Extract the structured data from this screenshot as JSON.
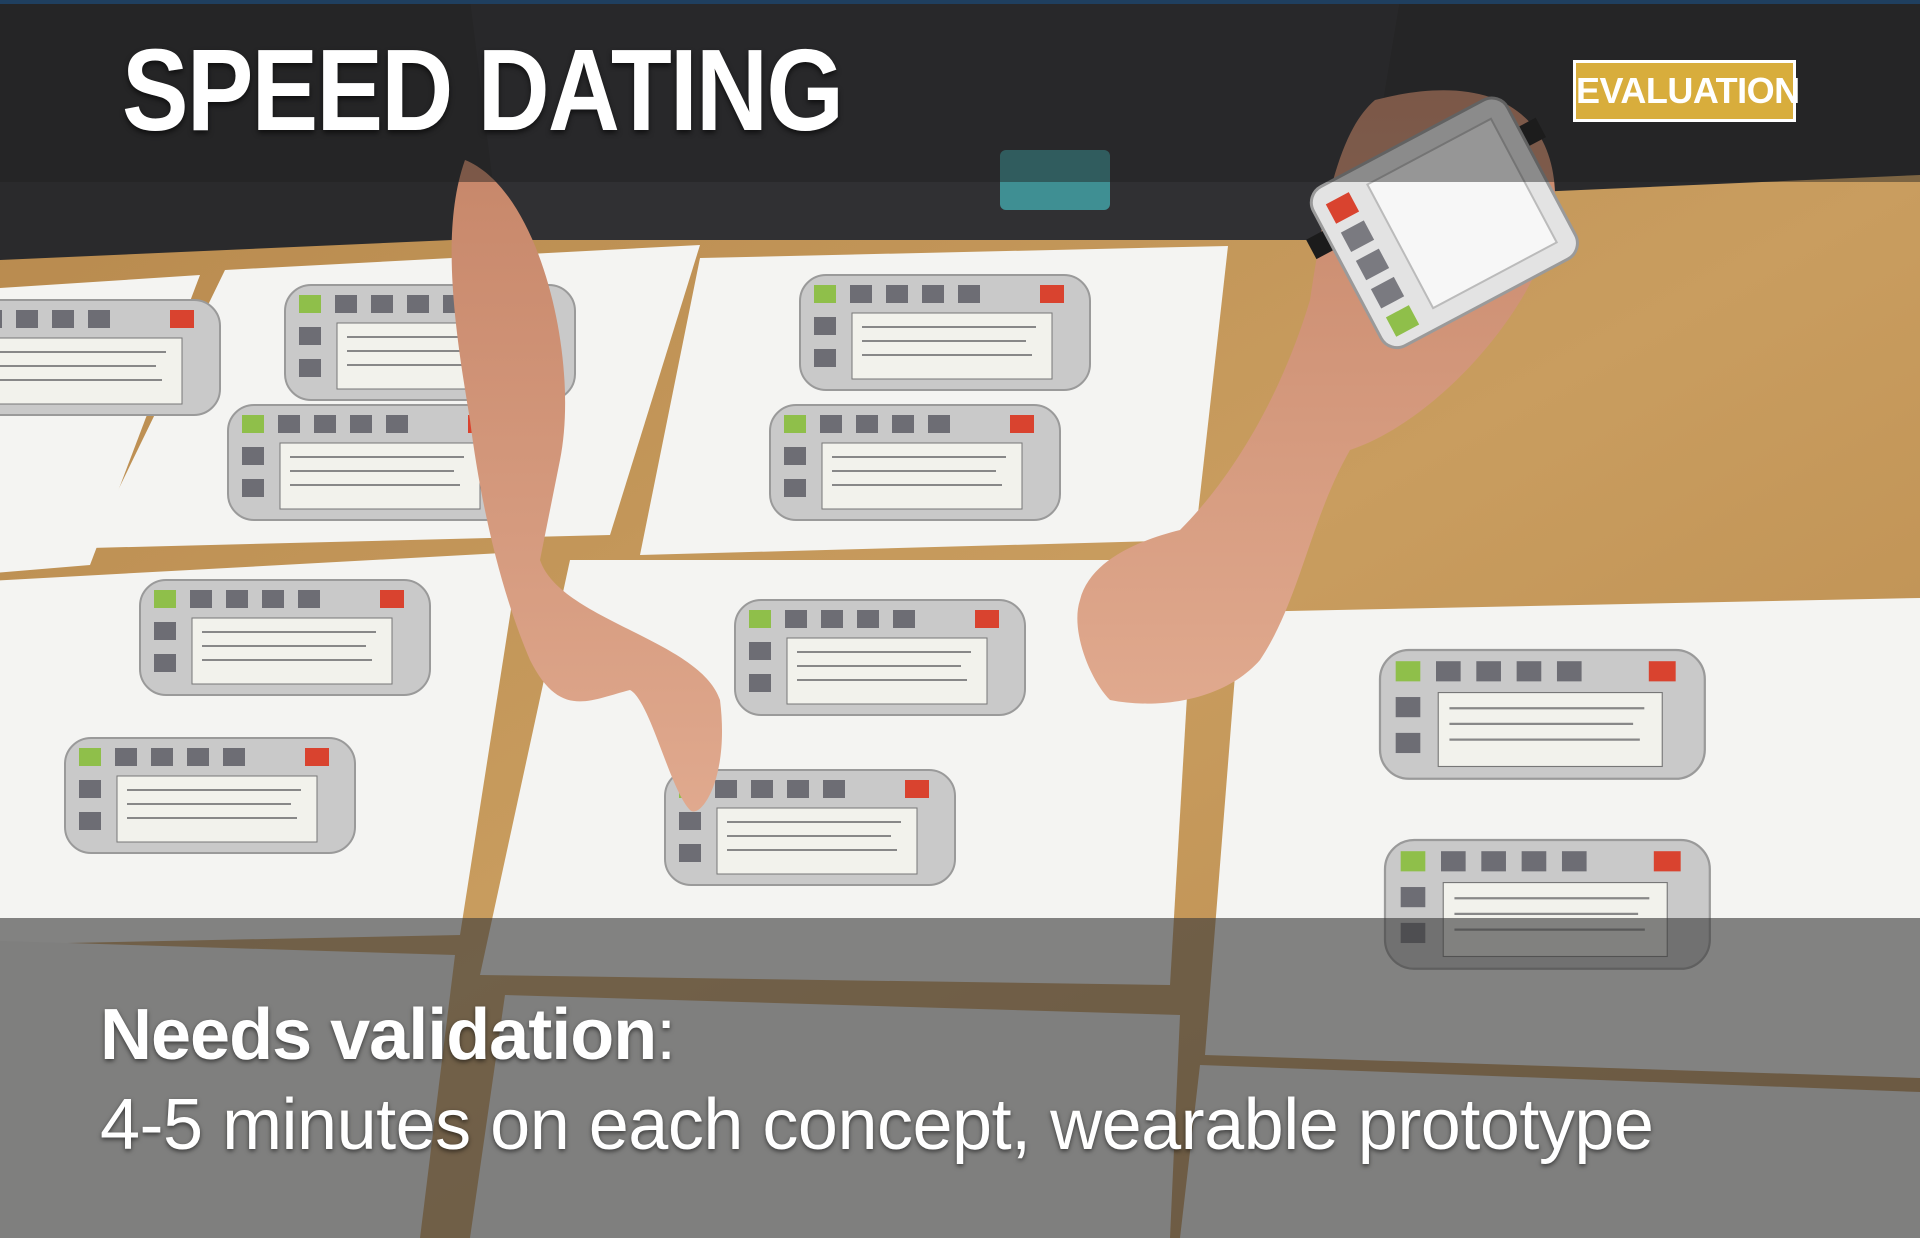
{
  "slide": {
    "title": "SPEED DATING",
    "badge": "EVALUATION",
    "caption": {
      "emphasis": "Needs validation",
      "punct": ":",
      "detail": "4-5 minutes on each concept, wearable prototype"
    }
  },
  "colors": {
    "badge_bg": "#d8ad3c",
    "title_text": "#ffffff",
    "table": "#c79a5a"
  }
}
